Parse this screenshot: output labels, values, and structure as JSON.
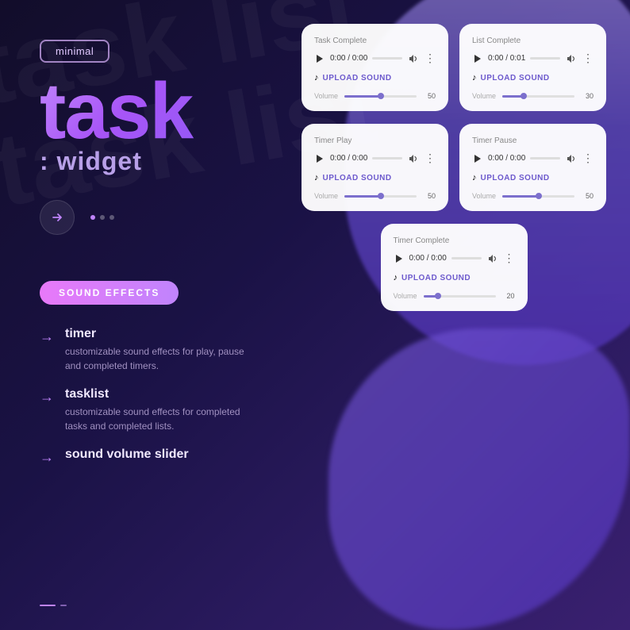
{
  "background": {
    "watermark_line1": "task list",
    "watermark_line2": "task list"
  },
  "left": {
    "badge": "minimal",
    "title_big": "task",
    "title_widget_colon": ":",
    "title_widget_text": "widget",
    "sound_badge": "SOUND EFFECTS",
    "features": [
      {
        "title": "timer",
        "desc": "customizable sound effects for play,\npause and completed timers."
      },
      {
        "title": "tasklist",
        "desc": "customizable sound effects for\ncompleted tasks and completed lists."
      },
      {
        "title": "sound volume slider",
        "desc": ""
      }
    ]
  },
  "cards": [
    {
      "id": "task-complete",
      "label": "Task Complete",
      "time": "0:00 / 0:00",
      "volume_value": "50",
      "volume_pct": 50,
      "upload_text": "UPLOAD SOUND"
    },
    {
      "id": "list-complete",
      "label": "List Complete",
      "time": "0:00 / 0:01",
      "volume_value": "30",
      "volume_pct": 30,
      "upload_text": "UPLOAD SOUND"
    },
    {
      "id": "timer-play",
      "label": "Timer Play",
      "time": "0:00 / 0:00",
      "volume_value": "50",
      "volume_pct": 50,
      "upload_text": "UPLOAD SOUND"
    },
    {
      "id": "timer-pause",
      "label": "Timer Pause",
      "time": "0:00 / 0:00",
      "volume_value": "50",
      "volume_pct": 50,
      "upload_text": "UPLOAD SOUND"
    },
    {
      "id": "timer-complete",
      "label": "Timer Complete",
      "time": "0:00 / 0:00",
      "volume_value": "20",
      "volume_pct": 20,
      "upload_text": "UPLOAD SOUND"
    }
  ]
}
